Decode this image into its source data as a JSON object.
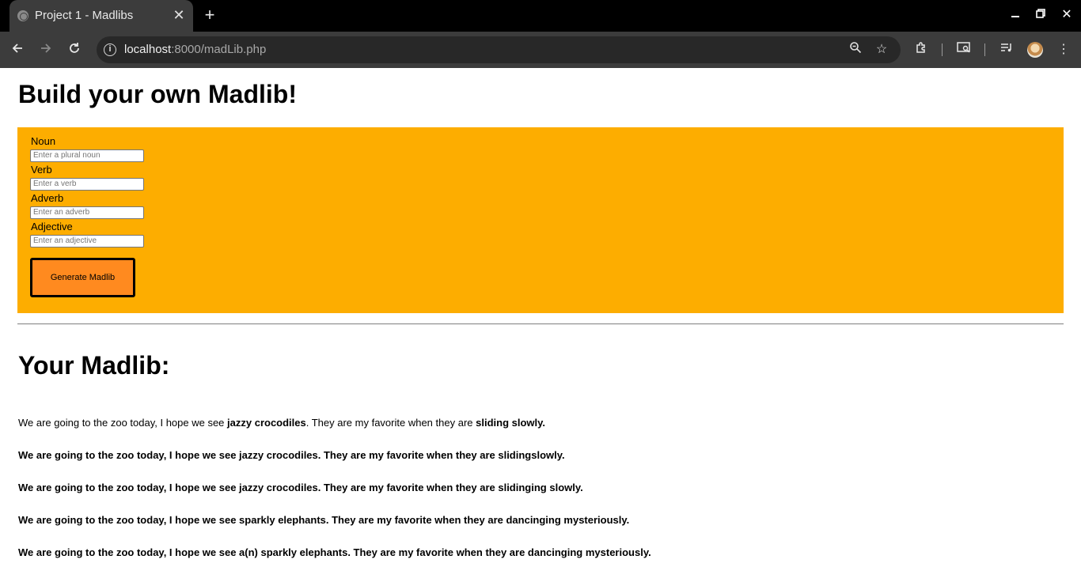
{
  "browser": {
    "tab_title": "Project 1 - Madlibs",
    "url_host": "localhost",
    "url_rest": ":8000/madLib.php"
  },
  "page": {
    "heading": "Build your own Madlib!",
    "form": {
      "fields": [
        {
          "label": "Noun",
          "placeholder": "Enter a plural noun"
        },
        {
          "label": "Verb",
          "placeholder": "Enter a verb"
        },
        {
          "label": "Adverb",
          "placeholder": "Enter an adverb"
        },
        {
          "label": "Adjective",
          "placeholder": "Enter an adjective"
        }
      ],
      "submit_label": "Generate Madlib"
    },
    "results_heading": "Your Madlib:",
    "first_result": {
      "part1": "We are going to the zoo today, I hope we see ",
      "noun_phrase": "jazzy crocodiles",
      "part2": ". They are my favorite when they are ",
      "verb_phrase": "sliding slowly."
    },
    "results": [
      "We are going to the zoo today, I hope we see jazzy crocodiles. They are my favorite when they are slidingslowly.",
      "We are going to the zoo today, I hope we see jazzy crocodiles. They are my favorite when they are slidinging slowly.",
      "We are going to the zoo today, I hope we see sparkly elephants. They are my favorite when they are dancinging mysteriously.",
      "We are going to the zoo today, I hope we see a(n) sparkly elephants. They are my favorite when they are dancinging mysteriously."
    ]
  },
  "colors": {
    "form_background": "#fdad00",
    "button_background": "#ff8a1f"
  }
}
